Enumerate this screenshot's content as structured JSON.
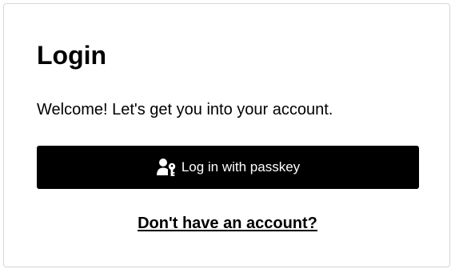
{
  "login": {
    "title": "Login",
    "welcome": "Welcome! Let's get you into your account.",
    "passkey_button_label": "Log in with passkey",
    "passkey_icon": "user-key-icon",
    "signup_link": "Don't have an account?"
  },
  "colors": {
    "button_background": "#000000",
    "button_text": "#ffffff",
    "card_border": "#d6d6d6",
    "text": "#000000"
  }
}
